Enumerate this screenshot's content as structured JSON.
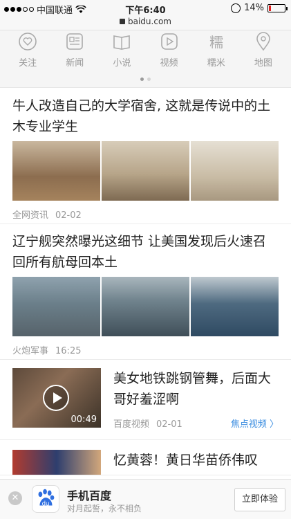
{
  "status_bar": {
    "carrier": "中国联通",
    "time": "下午6:40",
    "battery": "14%",
    "battery_level": 0.14
  },
  "url_bar": {
    "domain": "baidu.com"
  },
  "categories": [
    {
      "label": "关注",
      "icon": "heart-icon"
    },
    {
      "label": "新闻",
      "icon": "news-icon"
    },
    {
      "label": "小说",
      "icon": "book-icon"
    },
    {
      "label": "视频",
      "icon": "video-icon"
    },
    {
      "label": "糯米",
      "icon": "nuomi-icon"
    },
    {
      "label": "地图",
      "icon": "map-pin-icon"
    }
  ],
  "pager": {
    "pages": 2,
    "active": 1
  },
  "feed": [
    {
      "title": "牛人改造自己的大学宿舍, 这就是传说中的土木专业学生",
      "source": "全网资讯",
      "date": "02-02"
    },
    {
      "title": "辽宁舰突然曝光这细节 让美国发现后火速召回所有航母回本土",
      "source": "火炮军事",
      "date": "16:25"
    },
    {
      "title": "美女地铁跳钢管舞，后面大哥好羞涩啊",
      "source": "百度视频",
      "date": "02-01",
      "duration": "00:49",
      "tag": "焦点视频 〉"
    },
    {
      "title": "忆黄蓉！黄日华苗侨伟叹"
    }
  ],
  "app_banner": {
    "name": "手机百度",
    "slogan": "对月起誓，永不相负",
    "button": "立即体验",
    "logo_text": "du"
  },
  "colors": {
    "accent": "#3c8ee0",
    "battery_low": "#e02020"
  }
}
